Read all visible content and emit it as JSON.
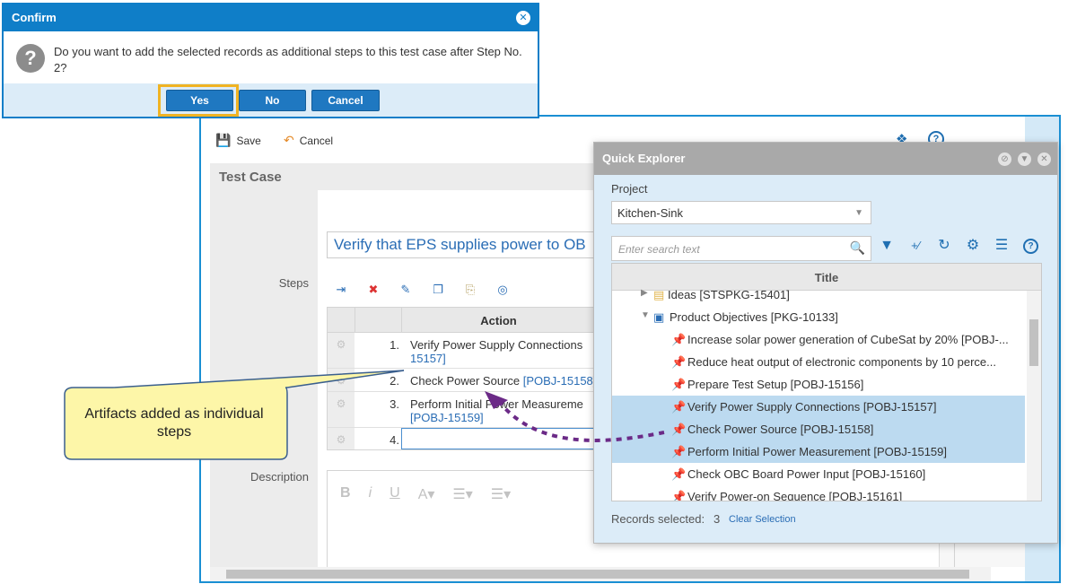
{
  "toolbar": {
    "save_label": "Save",
    "cancel_label": "Cancel"
  },
  "test_case": {
    "header": "Test Case",
    "name": "Verify that EPS supplies power to OB",
    "steps_label": "Steps",
    "description_label": "Description",
    "grid": {
      "action_header": "Action",
      "rows": [
        {
          "num": "1.",
          "text": "Verify Power Supply Connections ",
          "link": "15157]"
        },
        {
          "num": "2.",
          "text": "Check Power Source ",
          "link": "[POBJ-15158]"
        },
        {
          "num": "3.",
          "text": "Perform Initial Power Measureme",
          "link": "[POBJ-15159]"
        },
        {
          "num": "4.",
          "text": "",
          "link": ""
        }
      ]
    }
  },
  "quick_explorer": {
    "title": "Quick Explorer",
    "project_label": "Project",
    "project_value": "Kitchen-Sink",
    "search_placeholder": "Enter search text",
    "title_column": "Title",
    "tree": [
      {
        "text": "Ideas [STSPKG-15401]",
        "indent": 40,
        "selected": false,
        "kind": "folder"
      },
      {
        "text": "Product Objectives [PKG-10133]",
        "indent": 48,
        "selected": false,
        "kind": "folder-open"
      },
      {
        "text": "Increase solar power generation of CubeSat by 20% [POBJ-...",
        "indent": 84,
        "selected": false,
        "kind": "item"
      },
      {
        "text": "Reduce heat output of electronic components by 10 perce...",
        "indent": 84,
        "selected": false,
        "kind": "item"
      },
      {
        "text": "Prepare Test Setup [POBJ-15156]",
        "indent": 84,
        "selected": false,
        "kind": "item"
      },
      {
        "text": "Verify Power Supply Connections [POBJ-15157]",
        "indent": 84,
        "selected": true,
        "kind": "item"
      },
      {
        "text": "Check Power Source [POBJ-15158]",
        "indent": 84,
        "selected": true,
        "kind": "item"
      },
      {
        "text": "Perform Initial Power Measurement [POBJ-15159]",
        "indent": 84,
        "selected": true,
        "kind": "item"
      },
      {
        "text": "Check OBC Board Power Input [POBJ-15160]",
        "indent": 84,
        "selected": false,
        "kind": "item"
      },
      {
        "text": "Verify Power-on Sequence [POBJ-15161]",
        "indent": 84,
        "selected": false,
        "kind": "item"
      }
    ],
    "records_selected_label": "Records selected:",
    "records_selected_count": "3",
    "clear_selection_label": "Clear Selection"
  },
  "confirm": {
    "title": "Confirm",
    "message": "Do you want to add the selected records as additional steps to this test case after Step No. 2?",
    "yes_label": "Yes",
    "no_label": "No",
    "cancel_label": "Cancel"
  },
  "callout": {
    "text": "Artifacts added as individual steps"
  },
  "colors": {
    "accent": "#0f7ec8",
    "selected_row": "#bcdaf0",
    "highlight": "#f0b323",
    "arrow": "#6b2a87"
  }
}
